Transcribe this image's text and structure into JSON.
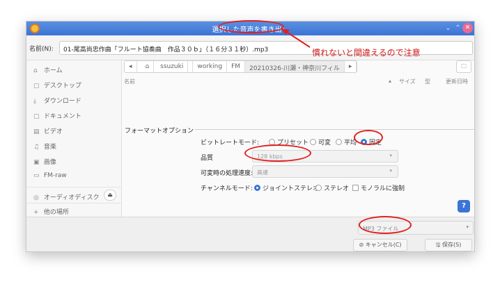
{
  "window": {
    "title": "選択した音声を書き出し"
  },
  "name_field": {
    "label": "名前(N):",
    "value": "01-尾高尚忠作曲「フルート協奏曲　作品３０ｂ」（１６分３１秒）.mp3"
  },
  "sidebar": {
    "items": [
      {
        "icon": "⌂",
        "label": "ホーム"
      },
      {
        "icon": "▢",
        "label": "デスクトップ"
      },
      {
        "icon": "⤓",
        "label": "ダウンロード"
      },
      {
        "icon": "▢",
        "label": "ドキュメント"
      },
      {
        "icon": "▤",
        "label": "ビデオ"
      },
      {
        "icon": "♫",
        "label": "音楽"
      },
      {
        "icon": "▣",
        "label": "画像"
      },
      {
        "icon": "▭",
        "label": "FM-raw"
      },
      {
        "icon": "◎",
        "label": "オーディオディスク"
      },
      {
        "icon": "+",
        "label": "他の場所"
      }
    ],
    "eject_icon": "⏏"
  },
  "path": {
    "back_icon": "◂",
    "home_icon": "⌂",
    "segments": [
      "ssuzuki",
      "working",
      "FM",
      "20210326-川瀬・神奈川フィル"
    ],
    "more_icon": "▸",
    "newfolder_icon": "🗀"
  },
  "list_header": {
    "name": "名前",
    "sort_icon": "▴",
    "size": "サイズ",
    "type": "型",
    "modified": "更新日時"
  },
  "format": {
    "title": "フォーマットオプション",
    "bitrate_mode_label": "ビットレートモード:",
    "bitrate_modes": [
      "プリセット",
      "可変",
      "平均",
      "固定"
    ],
    "quality_label": "品質",
    "quality_value": "128 kbps",
    "speed_label": "可変時の処理速度:",
    "speed_value": "高速",
    "channel_label": "チャンネルモード:",
    "channel_modes": [
      "ジョイントステレオ",
      "ステレオ"
    ],
    "force_mono": "モノラルに強制"
  },
  "help_icon": "?",
  "footer": {
    "file_type": "MP3 ファイル",
    "cancel": "キャンセル(C)",
    "cancel_icon": "⊘",
    "save": "保存(S)",
    "save_icon": "🖫"
  },
  "annotation": {
    "note": "慣れないと間違えるので注意",
    "color": "#e02020"
  },
  "colors": {
    "accent": "#3b74d6",
    "titlebar": "#3b74d6"
  }
}
